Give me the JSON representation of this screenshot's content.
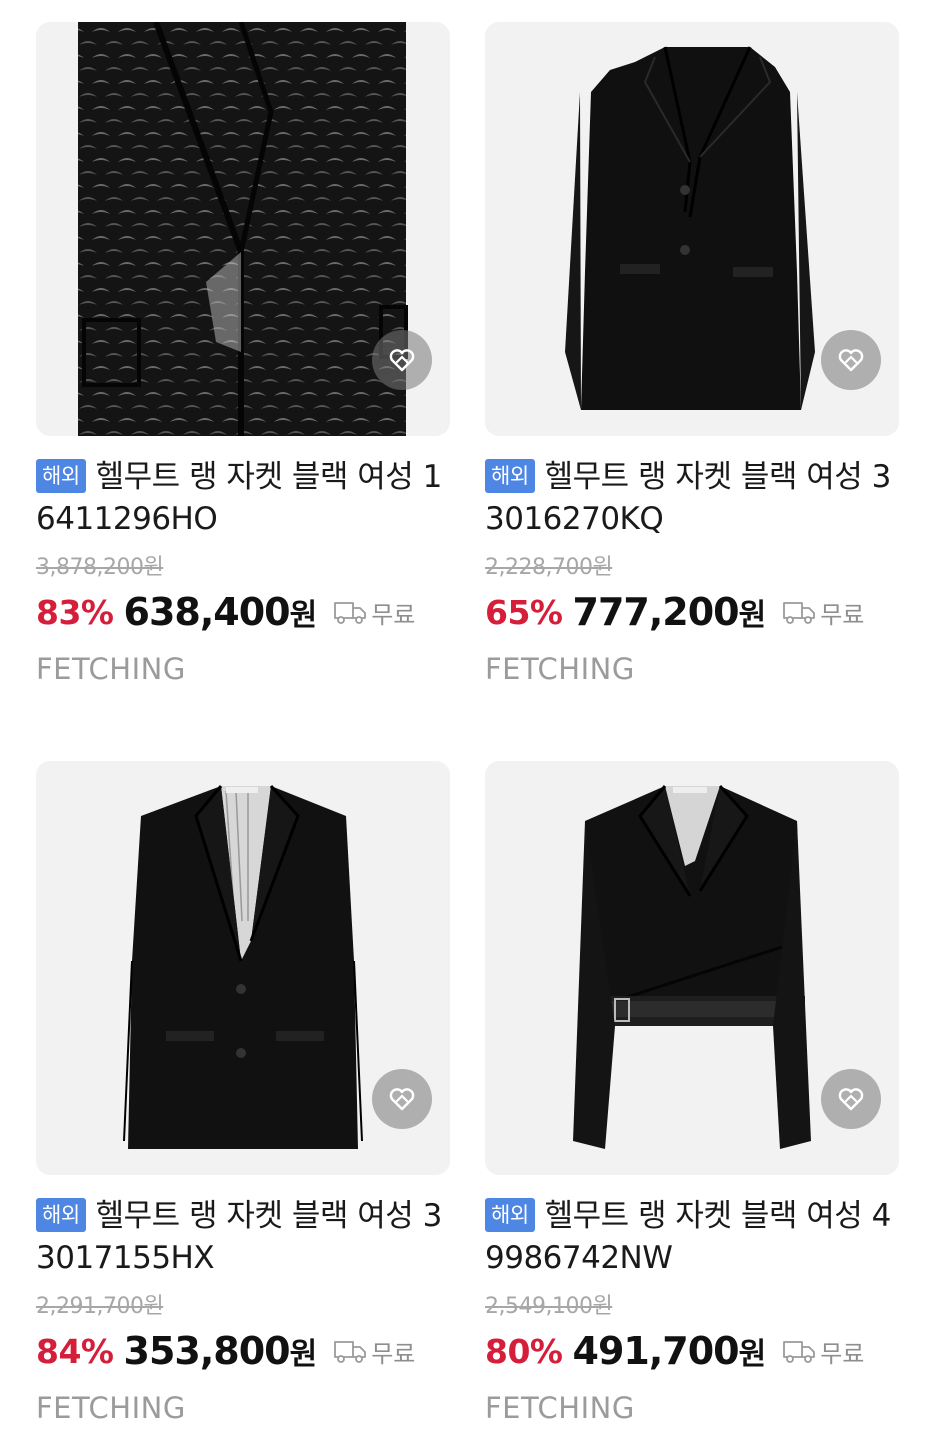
{
  "products": [
    {
      "badge": "해외",
      "title": "헬무트 랭 자켓 블랙 여성 16411296HO",
      "original_price": "3,878,200원",
      "discount": "83%",
      "price": "638,400",
      "currency": "원",
      "shipping": "무료",
      "seller": "FETCHING",
      "icon": "heart-icon"
    },
    {
      "badge": "해외",
      "title": "헬무트 랭 자켓 블랙 여성 33016270KQ",
      "original_price": "2,228,700원",
      "discount": "65%",
      "price": "777,200",
      "currency": "원",
      "shipping": "무료",
      "seller": "FETCHING",
      "icon": "heart-icon"
    },
    {
      "badge": "해외",
      "title": "헬무트 랭 자켓 블랙 여성 33017155HX",
      "original_price": "2,291,700원",
      "discount": "84%",
      "price": "353,800",
      "currency": "원",
      "shipping": "무료",
      "seller": "FETCHING",
      "icon": "heart-icon"
    },
    {
      "badge": "해외",
      "title": "헬무트 랭 자켓 블랙 여성 49986742NW",
      "original_price": "2,549,100원",
      "discount": "80%",
      "price": "491,700",
      "currency": "원",
      "shipping": "무료",
      "seller": "FETCHING",
      "icon": "heart-icon"
    }
  ],
  "colors": {
    "badge": "#4e86e4",
    "discount": "#d51e3a",
    "seller": "#9b9b9b"
  }
}
